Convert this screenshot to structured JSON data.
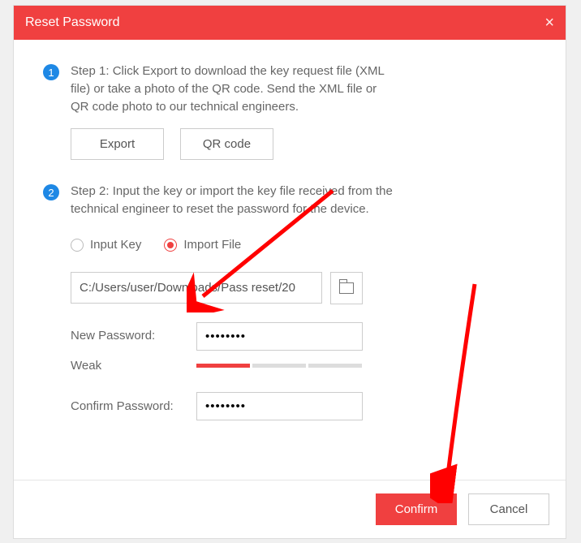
{
  "title": "Reset Password",
  "step1": {
    "num": "1",
    "text": "Step 1: Click Export to download the key request file (XML file) or take a photo of the QR code. Send the XML file or QR code photo to our technical engineers.",
    "export_label": "Export",
    "qr_label": "QR code"
  },
  "step2": {
    "num": "2",
    "text": "Step 2: Input the key or import the key file received from the technical engineer to reset the password for the device.",
    "radio_inputkey": "Input Key",
    "radio_importfile": "Import File",
    "selected_radio": "import_file",
    "file_path": "C:/Users/user/Downloads/Pass reset/20",
    "newpw_label": "New Password:",
    "newpw_value": "••••••••",
    "strength_label": "Weak",
    "confirmpw_label": "Confirm Password:",
    "confirmpw_value": "••••••••"
  },
  "footer": {
    "confirm": "Confirm",
    "cancel": "Cancel"
  },
  "colors": {
    "accent": "#f04040",
    "step_badge": "#1e88e5"
  }
}
